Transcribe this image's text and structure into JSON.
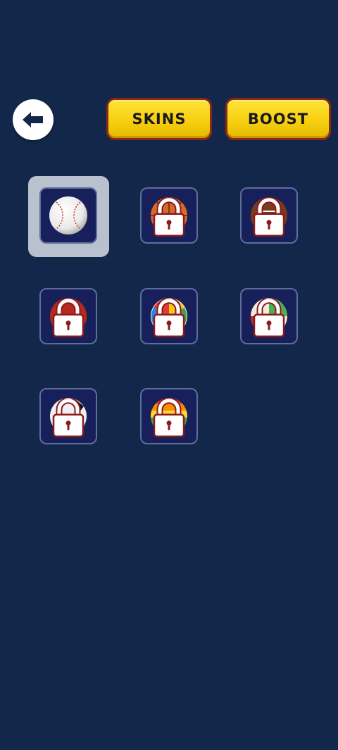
{
  "header": {
    "back_icon": "arrow-left-icon",
    "tabs": [
      {
        "label": "SKINS"
      },
      {
        "label": "BOOST"
      }
    ]
  },
  "skins": [
    {
      "ball": "baseball",
      "state": "selected",
      "icon": "baseball-icon"
    },
    {
      "ball": "basketball",
      "state": "locked",
      "icon": "lock-icon"
    },
    {
      "ball": "football",
      "state": "locked",
      "icon": "lock-icon"
    },
    {
      "ball": "red-ball",
      "state": "locked",
      "icon": "lock-icon"
    },
    {
      "ball": "beach-ball",
      "state": "locked",
      "icon": "lock-icon"
    },
    {
      "ball": "volleyball",
      "state": "locked",
      "icon": "lock-icon"
    },
    {
      "ball": "soccer-ball",
      "state": "locked",
      "icon": "lock-icon"
    },
    {
      "ball": "rainbow-ball",
      "state": "locked",
      "icon": "lock-icon"
    }
  ],
  "colors": {
    "background": "#13274b",
    "tab_yellow": "#f7cf10",
    "tab_border": "#8a2a12",
    "slot_fill": "#17205a",
    "selection_frame": "#b9c1cf",
    "lock_red": "#8b1a1a"
  }
}
